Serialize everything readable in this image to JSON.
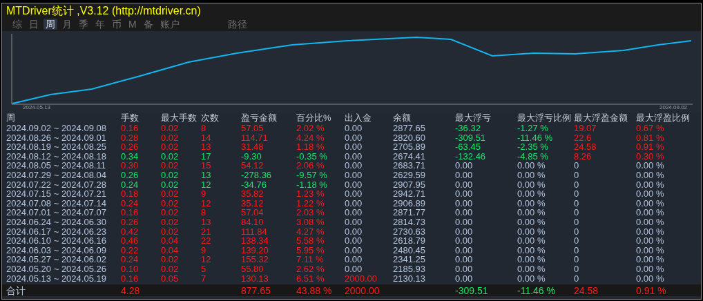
{
  "window": {
    "title": "MTDriver统计 ,V3.12 (http://mtdriver.cn)"
  },
  "tabs": [
    {
      "label": "综",
      "selected": false
    },
    {
      "label": "日",
      "selected": false
    },
    {
      "label": "周",
      "selected": true
    },
    {
      "label": "月",
      "selected": false
    },
    {
      "label": "季",
      "selected": false
    },
    {
      "label": "年",
      "selected": false
    },
    {
      "label": "币",
      "selected": false
    },
    {
      "label": "M",
      "selected": false
    },
    {
      "label": "备",
      "selected": false
    },
    {
      "label": "账户",
      "selected": false
    },
    {
      "label": "路径",
      "selected": false
    }
  ],
  "equity_chart": {
    "start_label": "2024.05.13",
    "end_label": "2024.09.02"
  },
  "table": {
    "columns": [
      "周",
      "手数",
      "最大手数",
      "次数",
      "盈亏金额",
      "百分比%",
      "出入金",
      "余额",
      "最大浮亏",
      "最大浮亏比例",
      "最大浮盈金额",
      "最大浮盈比例"
    ],
    "rows": [
      {
        "cells": [
          "2024.09.02 ~ 2024.09.08",
          "0.16",
          "0.02",
          "8",
          "57.05",
          "2.02 %",
          "0.00",
          "2877.65",
          "-36.32",
          "-1.27 %",
          "19.07",
          "0.67 %"
        ],
        "profit": true,
        "floating": true,
        "deposit": false
      },
      {
        "cells": [
          "2024.08.26 ~ 2024.09.01",
          "0.28",
          "0.02",
          "14",
          "114.71",
          "4.24 %",
          "0.00",
          "2820.60",
          "-309.51",
          "-11.46 %",
          "22.6",
          "0.81 %"
        ],
        "profit": true,
        "floating": true,
        "deposit": false
      },
      {
        "cells": [
          "2024.08.19 ~ 2024.08.25",
          "0.26",
          "0.02",
          "13",
          "31.48",
          "1.18 %",
          "0.00",
          "2705.89",
          "-63.45",
          "-2.35 %",
          "24.58",
          "0.91 %"
        ],
        "profit": true,
        "floating": true,
        "deposit": false
      },
      {
        "cells": [
          "2024.08.12 ~ 2024.08.18",
          "0.34",
          "0.02",
          "17",
          "-9.30",
          "-0.35 %",
          "0.00",
          "2674.41",
          "-132.46",
          "-4.85 %",
          "8.26",
          "0.30 %"
        ],
        "profit": false,
        "floating": true,
        "deposit": false
      },
      {
        "cells": [
          "2024.08.05 ~ 2024.08.11",
          "0.30",
          "0.02",
          "15",
          "54.12",
          "2.06 %",
          "0.00",
          "2683.71",
          "0.00",
          "0.00 %",
          "0",
          "0.00 %"
        ],
        "profit": true,
        "floating": false,
        "deposit": false
      },
      {
        "cells": [
          "2024.07.29 ~ 2024.08.04",
          "0.26",
          "0.02",
          "13",
          "-278.36",
          "-9.57 %",
          "0.00",
          "2629.59",
          "0.00",
          "0.00 %",
          "0",
          "0.00 %"
        ],
        "profit": false,
        "floating": false,
        "deposit": false
      },
      {
        "cells": [
          "2024.07.22 ~ 2024.07.28",
          "0.24",
          "0.02",
          "12",
          "-34.76",
          "-1.18 %",
          "0.00",
          "2907.95",
          "0.00",
          "0.00 %",
          "0",
          "0.00 %"
        ],
        "profit": false,
        "floating": false,
        "deposit": false
      },
      {
        "cells": [
          "2024.07.15 ~ 2024.07.21",
          "0.18",
          "0.02",
          "9",
          "35.82",
          "1.23 %",
          "0.00",
          "2942.71",
          "0.00",
          "0.00 %",
          "0",
          "0.00 %"
        ],
        "profit": true,
        "floating": false,
        "deposit": false
      },
      {
        "cells": [
          "2024.07.08 ~ 2024.07.14",
          "0.24",
          "0.02",
          "12",
          "35.12",
          "1.22 %",
          "0.00",
          "2906.89",
          "0.00",
          "0.00 %",
          "0",
          "0.00 %"
        ],
        "profit": true,
        "floating": false,
        "deposit": false
      },
      {
        "cells": [
          "2024.07.01 ~ 2024.07.07",
          "0.16",
          "0.02",
          "8",
          "57.04",
          "2.03 %",
          "0.00",
          "2871.77",
          "0.00",
          "0.00 %",
          "0",
          "0.00 %"
        ],
        "profit": true,
        "floating": false,
        "deposit": false
      },
      {
        "cells": [
          "2024.06.24 ~ 2024.06.30",
          "0.26",
          "0.02",
          "13",
          "84.10",
          "3.08 %",
          "0.00",
          "2814.73",
          "0.00",
          "0.00 %",
          "0",
          "0.00 %"
        ],
        "profit": true,
        "floating": false,
        "deposit": false
      },
      {
        "cells": [
          "2024.06.17 ~ 2024.06.23",
          "0.42",
          "0.02",
          "21",
          "111.84",
          "4.27 %",
          "0.00",
          "2730.63",
          "0.00",
          "0.00 %",
          "0",
          "0.00 %"
        ],
        "profit": true,
        "floating": false,
        "deposit": false
      },
      {
        "cells": [
          "2024.06.10 ~ 2024.06.16",
          "0.46",
          "0.04",
          "22",
          "138.34",
          "5.58 %",
          "0.00",
          "2618.79",
          "0.00",
          "0.00 %",
          "0",
          "0.00 %"
        ],
        "profit": true,
        "floating": false,
        "deposit": false
      },
      {
        "cells": [
          "2024.06.03 ~ 2024.06.09",
          "0.22",
          "0.04",
          "9",
          "139.20",
          "5.95 %",
          "0.00",
          "2480.45",
          "0.00",
          "0.00 %",
          "0",
          "0.00 %"
        ],
        "profit": true,
        "floating": false,
        "deposit": false
      },
      {
        "cells": [
          "2024.05.27 ~ 2024.06.02",
          "0.24",
          "0.02",
          "12",
          "155.32",
          "7.11 %",
          "0.00",
          "2341.25",
          "0.00",
          "0.00 %",
          "0",
          "0.00 %"
        ],
        "profit": true,
        "floating": false,
        "deposit": false
      },
      {
        "cells": [
          "2024.05.20 ~ 2024.05.26",
          "0.10",
          "0.02",
          "5",
          "55.80",
          "2.62 %",
          "0.00",
          "2185.93",
          "0.00",
          "0.00 %",
          "0",
          "0.00 %"
        ],
        "profit": true,
        "floating": false,
        "deposit": false
      },
      {
        "cells": [
          "2024.05.13 ~ 2024.05.19",
          "0.16",
          "0.05",
          "7",
          "130.13",
          "6.51 %",
          "2000.00",
          "2130.13",
          "0.00",
          "0.00 %",
          "0",
          "0.00 %"
        ],
        "profit": true,
        "floating": false,
        "deposit": true
      }
    ],
    "totals": {
      "label": "合计",
      "lots": "4.28",
      "pnl": "877.65",
      "pct": "43.88 %",
      "deposit": "2000.00",
      "max_float_loss": "-309.51",
      "max_float_loss_pct": "-11.46 %",
      "max_float_profit": "24.58",
      "max_float_profit_pct": "0.91 %"
    }
  }
}
